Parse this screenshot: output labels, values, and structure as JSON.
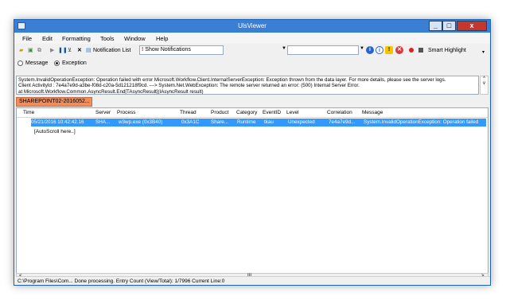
{
  "window": {
    "title": "UlsViewer"
  },
  "menu": [
    "File",
    "Edit",
    "Formatting",
    "Tools",
    "Window",
    "Help"
  ],
  "toolbar": {
    "notification_list": "Notification List",
    "show_notifications": "Show Notifications",
    "smart_highlight": "Smart Highlight"
  },
  "filter": {
    "message_label": "Message",
    "exception_label": "Exception",
    "selected": "Exception"
  },
  "message_text": [
    "System.InvalidOperationException: Operation failed with error Microsoft.Workflow.Client.InternalServerException: Exception thrown from the data layer. For more details, please see the server logs.",
    "Client ActivityId : 7e4a7e9d-a3be-f08d-c20a-5d121218f9cd. ---> System.Net.WebException: The remote server returned an error: (500) Internal Server Error.",
    "  at Microsoft.Workflow.Common.AsyncResult.End[TAsyncResult](IAsyncResult result)"
  ],
  "tab": {
    "label": "SHAREPOINT02-2016052..."
  },
  "grid": {
    "columns": [
      "Time",
      "Server",
      "Process",
      "Thread",
      "Product",
      "Category",
      "EventID",
      "Level",
      "Correlation",
      "Message"
    ],
    "rows": [
      [
        "05/21/2016 10:42:42.16",
        "SHA...",
        "w3wp.exe (0x3B40)",
        "0x3A1C",
        "Share...",
        "Runtime",
        "tkau",
        "Unexpected",
        "7e4a7e9d...",
        "System.InvalidOperationException: Operation failed"
      ]
    ],
    "autoscroll": "[AutoScroll here..]"
  },
  "scroll": {
    "thumb_label": "III"
  },
  "status": {
    "text": "C:\\Program Files\\Com...   Done processing.   Entry Count (View/Total): 1/7996   Current Line:0"
  }
}
